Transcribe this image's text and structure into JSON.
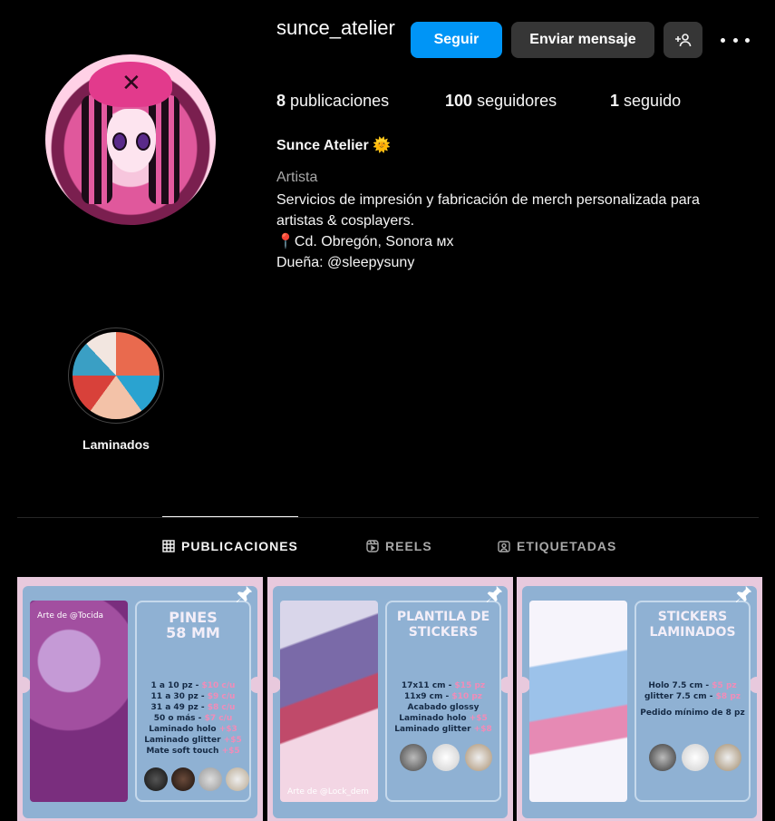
{
  "profile": {
    "username": "sunce_atelier",
    "follow_label": "Seguir",
    "message_label": "Enviar mensaje",
    "stats": [
      {
        "count": "8",
        "label": "publicaciones"
      },
      {
        "count": "100",
        "label": "seguidores"
      },
      {
        "count": "1",
        "label": "seguido"
      }
    ],
    "full_name": "Sunce Atelier 🌞",
    "category": "Artista",
    "bio_lines": [
      "Servicios de impresión y fabricación de merch personalizada para",
      "artistas & cosplayers.",
      "📍Cd. Obregón, Sonora ᴍx",
      "Dueña: @sleepysuny"
    ]
  },
  "highlights": [
    {
      "label": "Laminados"
    }
  ],
  "tabs": [
    {
      "label": "PUBLICACIONES",
      "icon": "grid-icon",
      "active": true
    },
    {
      "label": "REELS",
      "icon": "reels-icon",
      "active": false
    },
    {
      "label": "ETIQUETADAS",
      "icon": "tagged-icon",
      "active": false
    }
  ],
  "posts": [
    {
      "title_lines": [
        "PINES",
        "58 MM"
      ],
      "art_caption": "Arte de @Tocida",
      "lines": [
        {
          "text": "1 a 10 pz",
          "price": "$10 c/u"
        },
        {
          "text": "11 a 30 pz",
          "price": "$9 c/u"
        },
        {
          "text": "31 a 49 pz",
          "price": "$8 c/u"
        },
        {
          "text": "50 o más",
          "price": "$7 c/u"
        },
        {
          "text": "Laminado holo",
          "price": "+$3"
        },
        {
          "text": "Laminado glitter",
          "price": "+$5"
        },
        {
          "text": "Mate soft touch",
          "price": "+$5"
        }
      ]
    },
    {
      "title_lines": [
        "PLANTILA DE",
        "STICKERS"
      ],
      "art_caption": "Arte de @Lock_dem",
      "lines": [
        {
          "text": "17x11 cm",
          "price": "$15 pz"
        },
        {
          "text": "11x9 cm",
          "price": "$10 pz"
        },
        {
          "text": "Acabado glossy",
          "price": ""
        },
        {
          "text": "Laminado holo",
          "price": "+$5"
        },
        {
          "text": "Laminado glitter",
          "price": "+$8"
        }
      ]
    },
    {
      "title_lines": [
        "STICKERS",
        "LAMINADOS"
      ],
      "art_caption": "",
      "lines": [
        {
          "text": "Holo 7.5 cm",
          "price": "$5 pz"
        },
        {
          "text": "glitter 7.5 cm",
          "price": "$8 pz"
        },
        {
          "text": "Pedido mínimo de 8 pz",
          "price": ""
        }
      ]
    }
  ],
  "colors": {
    "accent": "#0095f6",
    "button_secondary": "#363636",
    "background": "#000000",
    "ticket_blue": "#8fb1d3",
    "ticket_pink": "#e8c9dd",
    "price_pink": "#f18cb8"
  }
}
